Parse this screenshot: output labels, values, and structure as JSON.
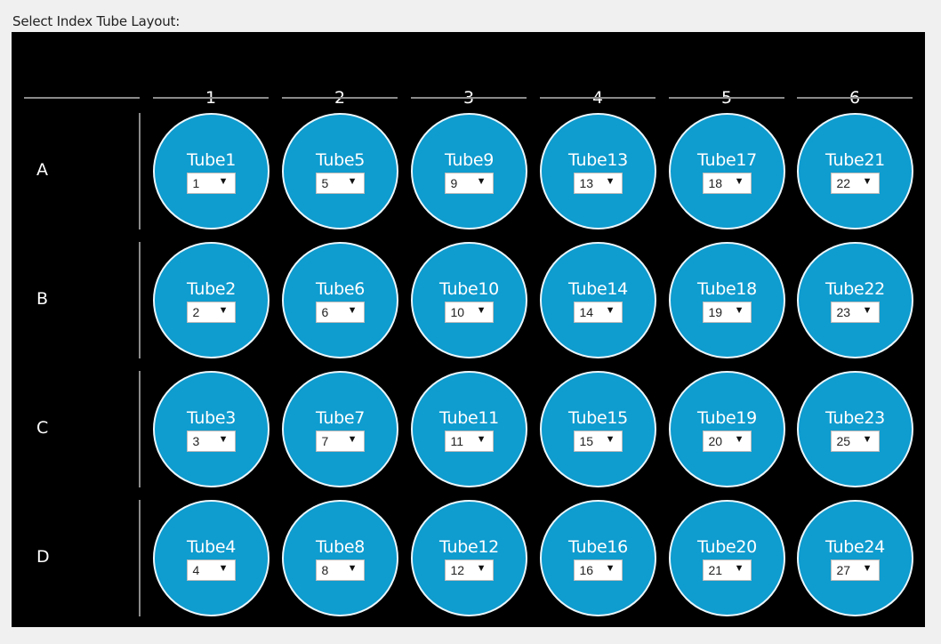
{
  "title": "Select Index Tube Layout:",
  "colors": {
    "panel_bg": "#000000",
    "tube_fill": "#0f9ccf",
    "tube_border": "#eaf6fb",
    "divider": "#8a8a8a",
    "page_bg": "#f0f0f0"
  },
  "columns": [
    "1",
    "2",
    "3",
    "4",
    "5",
    "6"
  ],
  "rows": [
    "A",
    "B",
    "C",
    "D"
  ],
  "dropdown_icon": "triangle-down-icon",
  "tubes": [
    [
      {
        "label": "Tube1",
        "value": "1"
      },
      {
        "label": "Tube5",
        "value": "5"
      },
      {
        "label": "Tube9",
        "value": "9"
      },
      {
        "label": "Tube13",
        "value": "13"
      },
      {
        "label": "Tube17",
        "value": "18"
      },
      {
        "label": "Tube21",
        "value": "22"
      }
    ],
    [
      {
        "label": "Tube2",
        "value": "2"
      },
      {
        "label": "Tube6",
        "value": "6"
      },
      {
        "label": "Tube10",
        "value": "10"
      },
      {
        "label": "Tube14",
        "value": "14"
      },
      {
        "label": "Tube18",
        "value": "19"
      },
      {
        "label": "Tube22",
        "value": "23"
      }
    ],
    [
      {
        "label": "Tube3",
        "value": "3"
      },
      {
        "label": "Tube7",
        "value": "7"
      },
      {
        "label": "Tube11",
        "value": "11"
      },
      {
        "label": "Tube15",
        "value": "15"
      },
      {
        "label": "Tube19",
        "value": "20"
      },
      {
        "label": "Tube23",
        "value": "25"
      }
    ],
    [
      {
        "label": "Tube4",
        "value": "4"
      },
      {
        "label": "Tube8",
        "value": "8"
      },
      {
        "label": "Tube12",
        "value": "12"
      },
      {
        "label": "Tube16",
        "value": "16"
      },
      {
        "label": "Tube20",
        "value": "21"
      },
      {
        "label": "Tube24",
        "value": "27"
      }
    ]
  ]
}
